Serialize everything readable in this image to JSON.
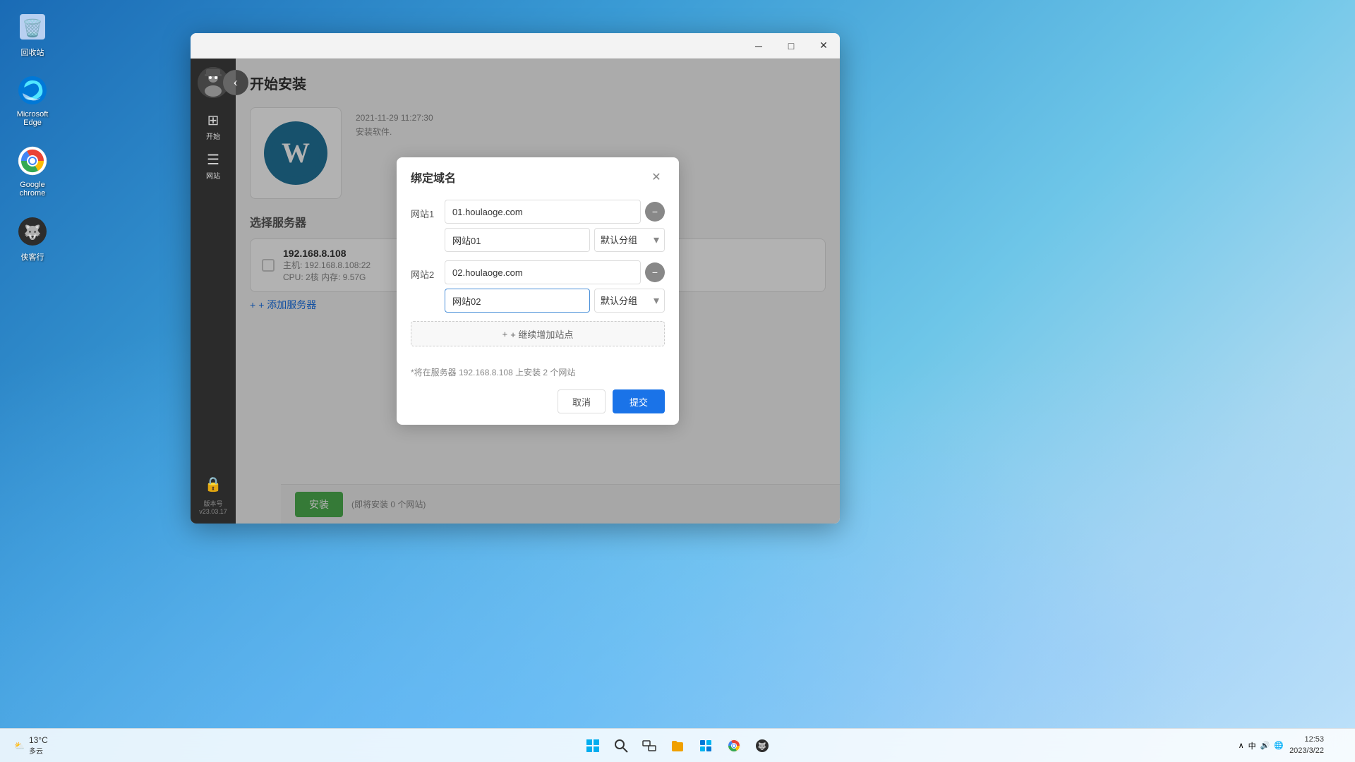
{
  "desktop": {
    "icons": [
      {
        "id": "recycle-bin",
        "label": "回收站",
        "icon": "🗑️"
      },
      {
        "id": "microsoft-edge",
        "label": "Microsoft Edge",
        "icon": "edge"
      },
      {
        "id": "google-chrome",
        "label": "Google chrome",
        "icon": "chrome"
      },
      {
        "id": "wolf-icon",
        "label": "侠客行",
        "icon": "wolf"
      }
    ]
  },
  "taskbar": {
    "weather": {
      "temp": "13°C",
      "condition": "多云"
    },
    "clock": {
      "time": "12:53",
      "date": "2023/3/22"
    },
    "tray": {
      "language": "中",
      "volume": "🔊",
      "network": "🌐"
    }
  },
  "app_window": {
    "title": "",
    "back_button": "‹",
    "page_title": "开始安装",
    "sidebar": {
      "nav_items": [
        {
          "id": "home",
          "icon": "⊞",
          "label": "开始"
        },
        {
          "id": "sites",
          "icon": "☰",
          "label": "网站"
        }
      ],
      "version_label": "版本号",
      "version_number": "v23.03.17"
    },
    "server_section": {
      "title": "选择服务器",
      "server": {
        "ip": "192.168.8.108",
        "host": "主机: 192.168.8.108:22",
        "cpu_memory": "CPU: 2核  内存: 9.57G"
      },
      "add_server_label": "+ 添加服务器"
    },
    "install_section": {
      "time_info": "2021-11-29 11:27:30",
      "software_note": "安装软件."
    },
    "bottom_bar": {
      "install_btn": "安装",
      "hint": "(即将安装 0 个网站)"
    }
  },
  "dialog": {
    "title": "绑定域名",
    "site1": {
      "label": "网站1",
      "domain": "01.houlaoge.com",
      "site_name": "网站01",
      "group": "默认分组"
    },
    "site2": {
      "label": "网站2",
      "domain": "02.houlaoge.com",
      "site_name": "网站02",
      "group": "默认分组"
    },
    "add_site_btn": "+ 继续增加站点",
    "footer_info": "*将在服务器 192.168.8.108 上安装 2 个网站",
    "cancel_btn": "取消",
    "submit_btn": "提交"
  }
}
